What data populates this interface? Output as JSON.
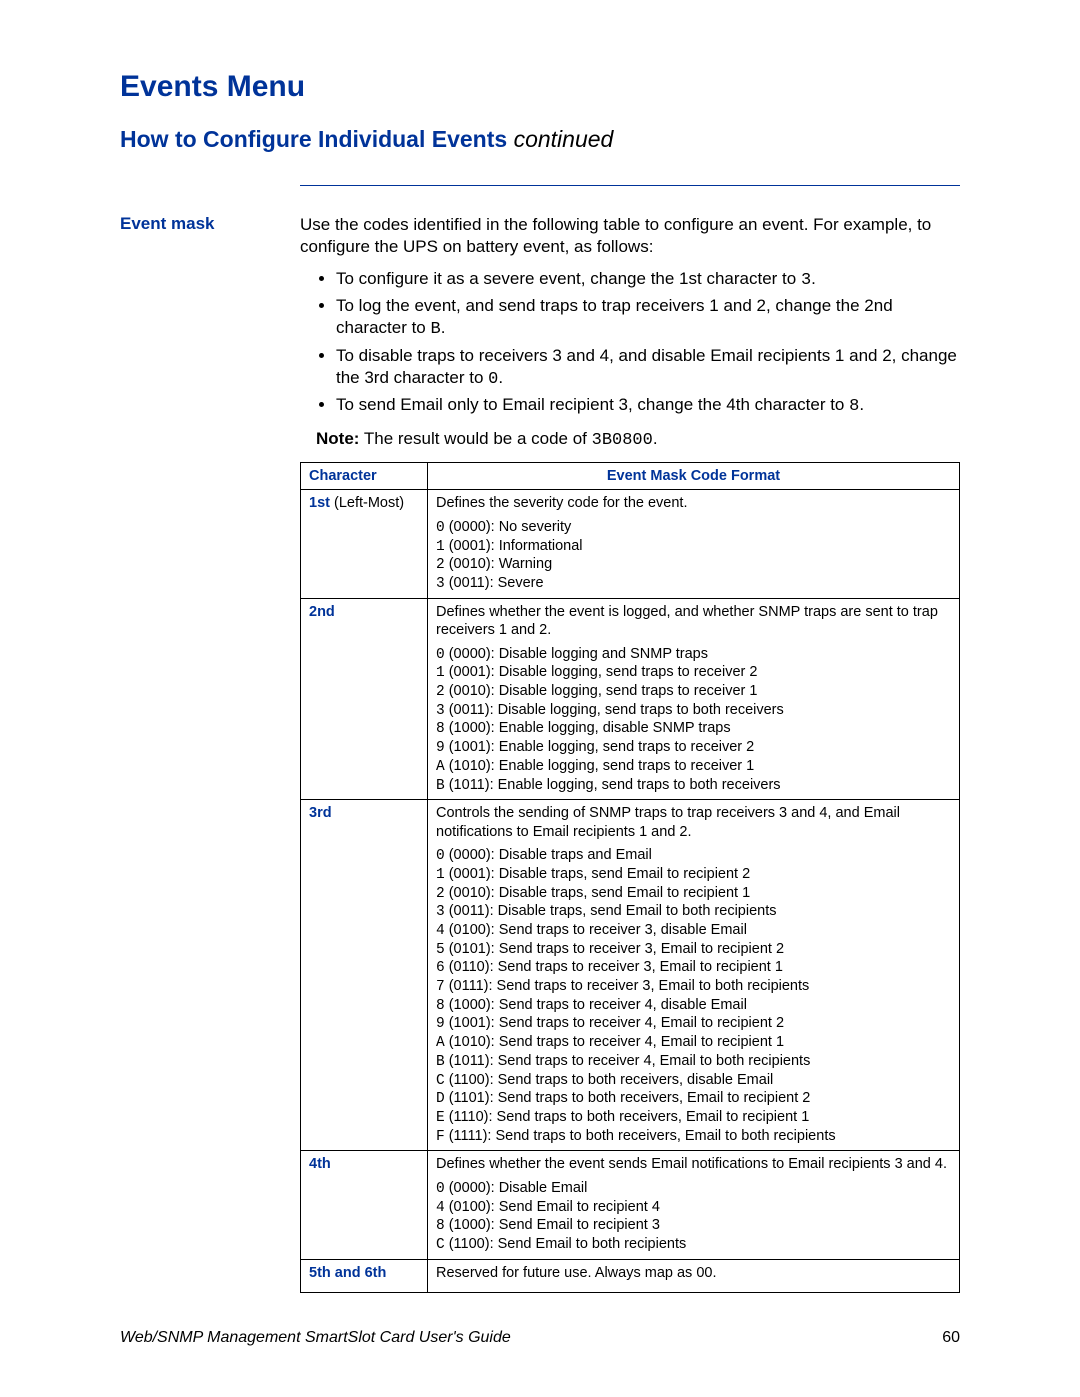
{
  "title": "Events Menu",
  "subtitle": "How to Configure Individual Events",
  "subtitle_cont": "continued",
  "margin_label": "Event mask",
  "intro": "Use the codes identified in the following table to configure an event. For example, to configure the UPS on battery event, as follows:",
  "bullets": [
    {
      "pre": "To configure it as a severe event, change the 1st character to ",
      "code": "3",
      "post": "."
    },
    {
      "pre": "To log the event, and send traps to trap receivers 1 and 2, change the 2nd character to ",
      "code": "B",
      "post": "."
    },
    {
      "pre": "To disable traps to receivers 3 and 4, and disable Email recipients 1 and 2, change the 3rd character to ",
      "code": "0",
      "post": "."
    },
    {
      "pre": "To send Email only to Email recipient 3, change the 4th character to ",
      "code": "8",
      "post": "."
    }
  ],
  "note_label": "Note:",
  "note_text_pre": "  The result would be a code of ",
  "note_code": "3B0800",
  "note_text_post": ".",
  "table": {
    "head_char": "Character",
    "head_fmt": "Event Mask Code Format",
    "rows": [
      {
        "char_bold": "1st",
        "char_rest": " (Left-Most)",
        "defn": "Defines the severity code for the event.",
        "codes": [
          {
            "c": "0",
            "bin": " (0000): ",
            "txt": "No severity"
          },
          {
            "c": "1",
            "bin": " (0001): ",
            "txt": "Informational"
          },
          {
            "c": "2",
            "bin": " (0010): ",
            "txt": "Warning"
          },
          {
            "c": "3",
            "bin": " (0011): ",
            "txt": "Severe"
          }
        ]
      },
      {
        "char_bold": "2nd",
        "char_rest": "",
        "defn": "Defines whether the event is logged, and whether SNMP traps are sent to trap receivers 1 and 2.",
        "codes": [
          {
            "c": "0",
            "bin": " (0000): ",
            "txt": "Disable logging and SNMP traps"
          },
          {
            "c": "1",
            "bin": " (0001): ",
            "txt": "Disable logging, send traps to receiver 2"
          },
          {
            "c": "2",
            "bin": " (0010): ",
            "txt": "Disable logging, send traps to receiver 1"
          },
          {
            "c": "3",
            "bin": " (0011): ",
            "txt": "Disable logging, send traps to both receivers"
          },
          {
            "c": "8",
            "bin": " (1000): ",
            "txt": "Enable logging, disable SNMP traps"
          },
          {
            "c": "9",
            "bin": " (1001): ",
            "txt": "Enable logging, send traps to receiver 2"
          },
          {
            "c": "A",
            "bin": " (1010): ",
            "txt": "Enable logging, send traps to receiver 1"
          },
          {
            "c": "B",
            "bin": " (1011): ",
            "txt": "Enable logging, send traps to both receivers"
          }
        ]
      },
      {
        "char_bold": "3rd",
        "char_rest": "",
        "defn": "Controls the sending of SNMP traps to trap receivers 3 and 4, and Email notifications to Email recipients 1 and 2.",
        "codes": [
          {
            "c": "0",
            "bin": " (0000): ",
            "txt": "Disable traps and Email"
          },
          {
            "c": "1",
            "bin": " (0001): ",
            "txt": "Disable traps, send Email to recipient 2"
          },
          {
            "c": "2",
            "bin": " (0010): ",
            "txt": "Disable traps, send Email to recipient 1"
          },
          {
            "c": "3",
            "bin": " (0011): ",
            "txt": "Disable traps, send Email to both recipients"
          },
          {
            "c": "4",
            "bin": " (0100): ",
            "txt": "Send traps to receiver 3, disable Email"
          },
          {
            "c": "5",
            "bin": " (0101): ",
            "txt": "Send traps to receiver 3, Email to recipient 2"
          },
          {
            "c": "6",
            "bin": " (0110): ",
            "txt": "Send traps to receiver 3, Email to recipient 1"
          },
          {
            "c": "7",
            "bin": " (0111): ",
            "txt": "Send traps to receiver 3, Email to both recipients"
          },
          {
            "c": "8",
            "bin": " (1000): ",
            "txt": "Send traps to receiver 4, disable Email"
          },
          {
            "c": "9",
            "bin": " (1001): ",
            "txt": "Send traps to receiver 4, Email to recipient 2"
          },
          {
            "c": "A",
            "bin": " (1010): ",
            "txt": "Send traps to receiver 4, Email to recipient 1"
          },
          {
            "c": "B",
            "bin": " (1011): ",
            "txt": "Send traps to receiver 4, Email to both recipients"
          },
          {
            "c": "C",
            "bin": " (1100): ",
            "txt": "Send traps to both receivers, disable Email"
          },
          {
            "c": "D",
            "bin": " (1101): ",
            "txt": "Send traps to both receivers, Email to recipient 2"
          },
          {
            "c": "E",
            "bin": " (1110): ",
            "txt": "Send traps to both receivers, Email to recipient 1"
          },
          {
            "c": "F",
            "bin": " (1111): ",
            "txt": "Send traps to both receivers, Email to both recipients"
          }
        ]
      },
      {
        "char_bold": "4th",
        "char_rest": "",
        "defn": "Defines whether the event sends Email notifications to Email recipients 3 and 4.",
        "codes": [
          {
            "c": "0",
            "bin": " (0000): ",
            "txt": "Disable Email"
          },
          {
            "c": "4",
            "bin": " (0100): ",
            "txt": "Send Email to recipient 4"
          },
          {
            "c": "8",
            "bin": " (1000): ",
            "txt": "Send Email to recipient 3"
          },
          {
            "c": "C",
            "bin": " (1100): ",
            "txt": "Send Email to both recipients"
          }
        ]
      },
      {
        "char_bold": "5th and 6th",
        "char_rest": "",
        "defn": "Reserved for future use. Always map as 00.",
        "codes": []
      }
    ]
  },
  "footer_title": "Web/SNMP Management SmartSlot Card User's Guide",
  "page_number": "60"
}
